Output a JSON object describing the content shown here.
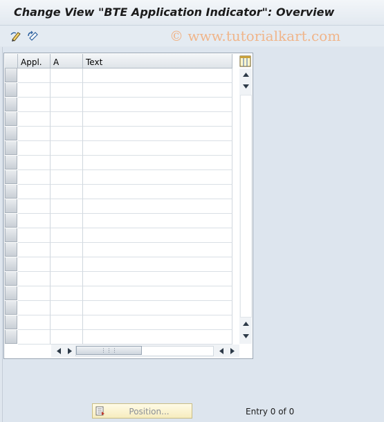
{
  "window": {
    "title": "Change View \"BTE Application Indicator\": Overview"
  },
  "toolbar": {
    "buttons": [
      {
        "name": "display-change-icon"
      },
      {
        "name": "undo-icon"
      }
    ]
  },
  "watermark": {
    "text": "© www.tutorialkart.com"
  },
  "table": {
    "columns": [
      "Appl.",
      "A",
      "Text"
    ],
    "row_count": 19,
    "rows": []
  },
  "footer": {
    "position_button_label": "Position...",
    "entry_text": "Entry 0 of 0"
  },
  "colors": {
    "background": "#dfe6ee",
    "grid_header": "#dfe4e9",
    "position_button": "#f6ecbe",
    "watermark": "#f0b58a"
  }
}
